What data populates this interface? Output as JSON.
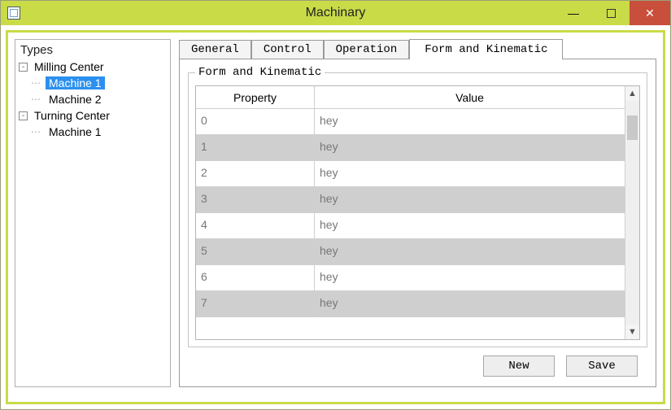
{
  "window": {
    "title": "Machinary"
  },
  "tree": {
    "heading": "Types",
    "nodes": [
      {
        "label": "Milling Center",
        "toggle": "-",
        "children": [
          {
            "label": "Machine 1",
            "selected": true
          },
          {
            "label": "Machine 2"
          }
        ]
      },
      {
        "label": "Turning Center",
        "toggle": "-",
        "children": [
          {
            "label": "Machine 1"
          }
        ]
      }
    ]
  },
  "tabs": [
    {
      "label": "General",
      "active": false
    },
    {
      "label": "Control",
      "active": false
    },
    {
      "label": "Operation",
      "active": false
    },
    {
      "label": "Form and Kinematic",
      "active": true
    }
  ],
  "fieldset": {
    "legend": "Form and Kinematic",
    "columns": {
      "property": "Property",
      "value": "Value"
    },
    "rows": [
      {
        "property": "0",
        "value": "hey"
      },
      {
        "property": "1",
        "value": "hey"
      },
      {
        "property": "2",
        "value": "hey"
      },
      {
        "property": "3",
        "value": "hey"
      },
      {
        "property": "4",
        "value": "hey"
      },
      {
        "property": "5",
        "value": "hey"
      },
      {
        "property": "6",
        "value": "hey"
      },
      {
        "property": "7",
        "value": "hey"
      }
    ]
  },
  "buttons": {
    "new": "New",
    "save": "Save"
  }
}
